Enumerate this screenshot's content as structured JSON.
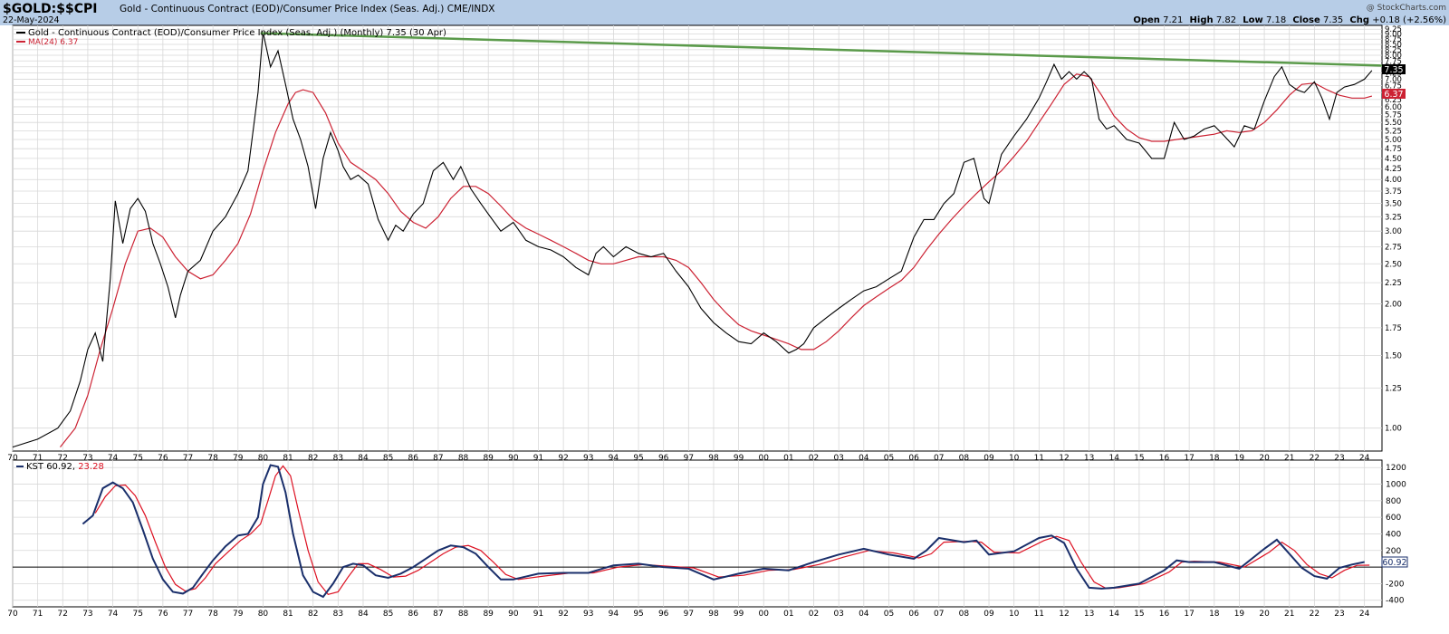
{
  "header": {
    "symbol": "$GOLD:$$CPI",
    "description": "Gold - Continuous Contract (EOD)/Consumer Price Index (Seas. Adj.)",
    "exchange": "CME/INDX",
    "date": "22-May-2024",
    "watermark": "@ StockCharts.com",
    "quote": {
      "open_label": "Open",
      "open": "7.21",
      "high_label": "High",
      "high": "7.82",
      "low_label": "Low",
      "low": "7.18",
      "close_label": "Close",
      "close": "7.35",
      "chg_label": "Chg",
      "chg": "+0.18 (+2.56%)"
    }
  },
  "colors": {
    "header_bg": "#b7cde7",
    "price": "#000000",
    "ma": "#cc2233",
    "trendline": "#5a9a4a",
    "kst": "#1a2f6b",
    "kst_signal": "#dd1122",
    "grid": "#d8d8d8"
  },
  "chart_data": [
    {
      "type": "line",
      "panel": "price",
      "scale": "log",
      "legend": [
        {
          "label": "Gold - Continuous Contract (EOD)/Consumer Price Index (Seas. Adj.) (Monthly) 7.35 (30 Apr)"
        },
        {
          "label": "MA(24) 6.37"
        }
      ],
      "x_ticks": [
        "70",
        "71",
        "72",
        "73",
        "74",
        "75",
        "76",
        "77",
        "78",
        "79",
        "80",
        "81",
        "82",
        "83",
        "84",
        "85",
        "86",
        "87",
        "88",
        "89",
        "90",
        "91",
        "92",
        "93",
        "94",
        "95",
        "96",
        "97",
        "98",
        "99",
        "00",
        "01",
        "02",
        "03",
        "04",
        "05",
        "06",
        "07",
        "08",
        "09",
        "10",
        "11",
        "12",
        "13",
        "14",
        "15",
        "16",
        "17",
        "18",
        "19",
        "20",
        "21",
        "22",
        "23",
        "24"
      ],
      "y_ticks": [
        "1.00",
        "1.25",
        "1.50",
        "1.75",
        "2.00",
        "2.25",
        "2.50",
        "2.75",
        "3.00",
        "3.25",
        "3.50",
        "3.75",
        "4.00",
        "4.25",
        "4.50",
        "4.75",
        "5.00",
        "5.25",
        "5.50",
        "5.75",
        "6.00",
        "6.25",
        "6.50",
        "6.75",
        "7.00",
        "7.25",
        "7.50",
        "7.75",
        "8.00",
        "8.25",
        "8.50",
        "8.75",
        "9.00",
        "9.25"
      ],
      "ylim": [
        0.88,
        9.45
      ],
      "xlim": [
        1970.0,
        2024.7
      ],
      "price_series": {
        "name": "Gold - Continuous Contract (EOD)/Consumer Price Index (Seas. Adj.)",
        "x": [
          1970.0,
          1971.0,
          1971.8,
          1972.3,
          1972.7,
          1973.0,
          1973.3,
          1973.6,
          1973.9,
          1974.1,
          1974.4,
          1974.7,
          1975.0,
          1975.3,
          1975.6,
          1975.9,
          1976.2,
          1976.5,
          1976.7,
          1977.0,
          1977.5,
          1978.0,
          1978.5,
          1979.0,
          1979.4,
          1979.8,
          1980.0,
          1980.3,
          1980.6,
          1980.9,
          1981.2,
          1981.5,
          1981.8,
          1982.1,
          1982.4,
          1982.7,
          1983.0,
          1983.2,
          1983.5,
          1983.8,
          1984.2,
          1984.6,
          1985.0,
          1985.3,
          1985.6,
          1986.0,
          1986.4,
          1986.8,
          1987.2,
          1987.6,
          1987.9,
          1988.3,
          1988.7,
          1989.0,
          1989.5,
          1990.0,
          1990.5,
          1991.0,
          1991.5,
          1992.0,
          1992.5,
          1993.0,
          1993.3,
          1993.6,
          1994.0,
          1994.5,
          1995.0,
          1995.5,
          1996.0,
          1996.5,
          1997.0,
          1997.5,
          1998.0,
          1998.5,
          1999.0,
          1999.5,
          2000.0,
          2000.5,
          2001.0,
          2001.3,
          2001.6,
          2002.0,
          2002.5,
          2003.0,
          2003.5,
          2004.0,
          2004.5,
          2005.0,
          2005.5,
          2006.0,
          2006.4,
          2006.8,
          2007.2,
          2007.6,
          2008.0,
          2008.4,
          2008.8,
          2009.0,
          2009.5,
          2010.0,
          2010.5,
          2011.0,
          2011.3,
          2011.6,
          2011.9,
          2012.2,
          2012.5,
          2012.8,
          2013.1,
          2013.4,
          2013.7,
          2014.0,
          2014.5,
          2015.0,
          2015.5,
          2016.0,
          2016.4,
          2016.8,
          2017.2,
          2017.6,
          2018.0,
          2018.4,
          2018.8,
          2019.2,
          2019.6,
          2020.0,
          2020.4,
          2020.7,
          2021.0,
          2021.3,
          2021.6,
          2022.0,
          2022.3,
          2022.6,
          2022.9,
          2023.2,
          2023.6,
          2024.0,
          2024.3
        ],
        "y": [
          0.9,
          0.94,
          1.0,
          1.1,
          1.3,
          1.55,
          1.7,
          1.45,
          2.3,
          3.55,
          2.8,
          3.4,
          3.6,
          3.35,
          2.8,
          2.5,
          2.2,
          1.85,
          2.1,
          2.4,
          2.55,
          3.0,
          3.25,
          3.7,
          4.2,
          6.5,
          9.1,
          7.5,
          8.2,
          6.8,
          5.6,
          5.0,
          4.3,
          3.4,
          4.5,
          5.2,
          4.7,
          4.3,
          4.0,
          4.1,
          3.9,
          3.2,
          2.85,
          3.1,
          3.0,
          3.3,
          3.5,
          4.2,
          4.4,
          4.0,
          4.3,
          3.8,
          3.5,
          3.3,
          3.0,
          3.15,
          2.85,
          2.75,
          2.7,
          2.6,
          2.45,
          2.35,
          2.65,
          2.75,
          2.6,
          2.75,
          2.65,
          2.6,
          2.65,
          2.4,
          2.2,
          1.95,
          1.8,
          1.7,
          1.62,
          1.6,
          1.7,
          1.62,
          1.52,
          1.55,
          1.6,
          1.75,
          1.85,
          1.95,
          2.05,
          2.15,
          2.2,
          2.3,
          2.4,
          2.9,
          3.2,
          3.2,
          3.5,
          3.7,
          4.4,
          4.5,
          3.6,
          3.5,
          4.6,
          5.1,
          5.6,
          6.3,
          6.9,
          7.6,
          7.0,
          7.3,
          7.0,
          7.3,
          7.0,
          5.6,
          5.3,
          5.4,
          5.0,
          4.9,
          4.5,
          4.5,
          5.5,
          5.0,
          5.1,
          5.3,
          5.4,
          5.1,
          4.8,
          5.4,
          5.3,
          6.2,
          7.1,
          7.5,
          6.8,
          6.6,
          6.5,
          6.9,
          6.3,
          5.6,
          6.5,
          6.7,
          6.8,
          7.0,
          7.35
        ]
      },
      "ma_series": {
        "name": "MA(24)",
        "x": [
          1971.9,
          1972.5,
          1973.0,
          1973.5,
          1974.0,
          1974.5,
          1975.0,
          1975.5,
          1976.0,
          1976.5,
          1977.0,
          1977.5,
          1978.0,
          1978.5,
          1979.0,
          1979.5,
          1980.0,
          1980.5,
          1981.0,
          1981.3,
          1981.6,
          1982.0,
          1982.5,
          1983.0,
          1983.5,
          1984.0,
          1984.5,
          1985.0,
          1985.5,
          1986.0,
          1986.5,
          1987.0,
          1987.5,
          1988.0,
          1988.5,
          1989.0,
          1989.5,
          1990.0,
          1990.5,
          1991.0,
          1991.5,
          1992.0,
          1992.5,
          1993.0,
          1993.5,
          1994.0,
          1994.5,
          1995.0,
          1995.5,
          1996.0,
          1996.5,
          1997.0,
          1997.5,
          1998.0,
          1998.5,
          1999.0,
          1999.5,
          2000.0,
          2000.5,
          2001.0,
          2001.5,
          2002.0,
          2002.5,
          2003.0,
          2003.5,
          2004.0,
          2004.5,
          2005.0,
          2005.5,
          2006.0,
          2006.5,
          2007.0,
          2007.5,
          2008.0,
          2008.5,
          2009.0,
          2009.5,
          2010.0,
          2010.5,
          2011.0,
          2011.5,
          2012.0,
          2012.5,
          2013.0,
          2013.5,
          2014.0,
          2014.5,
          2015.0,
          2015.5,
          2016.0,
          2016.5,
          2017.0,
          2017.5,
          2018.0,
          2018.5,
          2019.0,
          2019.5,
          2020.0,
          2020.5,
          2021.0,
          2021.5,
          2022.0,
          2022.5,
          2023.0,
          2023.5,
          2024.0,
          2024.3
        ],
        "y": [
          0.9,
          1.0,
          1.2,
          1.55,
          1.95,
          2.5,
          3.0,
          3.05,
          2.9,
          2.6,
          2.4,
          2.3,
          2.35,
          2.55,
          2.8,
          3.3,
          4.2,
          5.2,
          6.1,
          6.5,
          6.6,
          6.5,
          5.8,
          4.9,
          4.4,
          4.2,
          4.0,
          3.7,
          3.35,
          3.15,
          3.05,
          3.25,
          3.6,
          3.85,
          3.85,
          3.7,
          3.45,
          3.2,
          3.05,
          2.95,
          2.85,
          2.75,
          2.65,
          2.55,
          2.5,
          2.5,
          2.55,
          2.6,
          2.6,
          2.6,
          2.55,
          2.45,
          2.25,
          2.05,
          1.9,
          1.78,
          1.72,
          1.68,
          1.64,
          1.6,
          1.55,
          1.55,
          1.62,
          1.72,
          1.85,
          1.98,
          2.08,
          2.18,
          2.28,
          2.45,
          2.7,
          2.95,
          3.2,
          3.45,
          3.7,
          3.95,
          4.2,
          4.55,
          4.95,
          5.5,
          6.1,
          6.8,
          7.2,
          7.1,
          6.4,
          5.7,
          5.3,
          5.05,
          4.95,
          4.95,
          5.0,
          5.05,
          5.1,
          5.15,
          5.25,
          5.2,
          5.25,
          5.5,
          5.9,
          6.4,
          6.8,
          6.85,
          6.6,
          6.4,
          6.3,
          6.3,
          6.37
        ]
      },
      "trendline": {
        "x": [
          1979.9,
          2024.7
        ],
        "y": [
          9.05,
          7.55
        ]
      },
      "last_value_labels": {
        "price": "7.35",
        "ma": "6.37"
      }
    },
    {
      "type": "line",
      "panel": "KST",
      "legend": [
        {
          "label": "KST 60.92,",
          "value": "60.92"
        },
        {
          "label": "23.28",
          "value": "23.28"
        }
      ],
      "x_ticks": [
        "70",
        "71",
        "72",
        "73",
        "74",
        "75",
        "76",
        "77",
        "78",
        "79",
        "80",
        "81",
        "82",
        "83",
        "84",
        "85",
        "86",
        "87",
        "88",
        "89",
        "90",
        "91",
        "92",
        "93",
        "94",
        "95",
        "96",
        "97",
        "98",
        "99",
        "00",
        "01",
        "02",
        "03",
        "04",
        "05",
        "06",
        "07",
        "08",
        "09",
        "10",
        "11",
        "12",
        "13",
        "14",
        "15",
        "16",
        "17",
        "18",
        "19",
        "20",
        "21",
        "22",
        "23",
        "24"
      ],
      "y_ticks": [
        "1200",
        "1000",
        "800",
        "600",
        "400",
        "200",
        "-200",
        "-400"
      ],
      "ylim": [
        -480,
        1290
      ],
      "zero_line": 0,
      "last_value_label": "60.92",
      "kst_series": {
        "name": "KST",
        "x": [
          1972.8,
          1973.2,
          1973.6,
          1974.0,
          1974.4,
          1974.8,
          1975.2,
          1975.6,
          1976.0,
          1976.4,
          1976.8,
          1977.2,
          1977.6,
          1978.0,
          1978.5,
          1979.0,
          1979.4,
          1979.8,
          1980.0,
          1980.3,
          1980.6,
          1980.9,
          1981.2,
          1981.6,
          1982.0,
          1982.4,
          1982.8,
          1983.2,
          1983.6,
          1984.0,
          1984.5,
          1985.0,
          1985.5,
          1986.0,
          1986.5,
          1987.0,
          1987.5,
          1988.0,
          1988.5,
          1989.0,
          1989.5,
          1990.0,
          1991.0,
          1992.0,
          1993.0,
          1994.0,
          1995.0,
          1996.0,
          1997.0,
          1998.0,
          1999.0,
          2000.0,
          2001.0,
          2002.0,
          2003.0,
          2004.0,
          2005.0,
          2006.0,
          2006.5,
          2007.0,
          2008.0,
          2008.5,
          2009.0,
          2010.0,
          2011.0,
          2011.5,
          2012.0,
          2012.5,
          2013.0,
          2013.5,
          2014.0,
          2015.0,
          2016.0,
          2016.5,
          2017.0,
          2018.0,
          2019.0,
          2020.0,
          2020.5,
          2021.0,
          2021.5,
          2022.0,
          2022.5,
          2023.0,
          2023.5,
          2024.0,
          2024.3
        ],
        "y": [
          520,
          620,
          950,
          1020,
          950,
          780,
          450,
          100,
          -150,
          -300,
          -320,
          -250,
          -80,
          80,
          250,
          380,
          400,
          600,
          1000,
          1230,
          1210,
          900,
          400,
          -100,
          -300,
          -360,
          -200,
          0,
          40,
          20,
          -100,
          -130,
          -80,
          0,
          100,
          200,
          260,
          240,
          160,
          0,
          -150,
          -150,
          -80,
          -70,
          -70,
          20,
          40,
          0,
          -20,
          -150,
          -80,
          -20,
          -40,
          60,
          150,
          220,
          150,
          100,
          200,
          350,
          300,
          320,
          150,
          190,
          350,
          380,
          290,
          -20,
          -250,
          -260,
          -250,
          -200,
          -40,
          80,
          60,
          60,
          -20,
          220,
          330,
          160,
          -10,
          -110,
          -140,
          -10,
          30,
          61
        ]
      },
      "signal_series": {
        "name": "Signal",
        "x": [
          1973.3,
          1973.7,
          1974.1,
          1974.5,
          1974.9,
          1975.3,
          1975.7,
          1976.1,
          1976.5,
          1976.9,
          1977.3,
          1977.7,
          1978.1,
          1978.6,
          1979.1,
          1979.5,
          1979.9,
          1980.2,
          1980.5,
          1980.8,
          1981.1,
          1981.4,
          1981.8,
          1982.2,
          1982.6,
          1983.0,
          1983.4,
          1983.8,
          1984.2,
          1984.7,
          1985.2,
          1985.7,
          1986.2,
          1986.7,
          1987.2,
          1987.7,
          1988.2,
          1988.7,
          1989.2,
          1989.7,
          1990.2,
          1991.2,
          1992.2,
          1993.2,
          1994.2,
          1995.2,
          1996.2,
          1997.2,
          1998.2,
          1999.2,
          2000.2,
          2001.2,
          2002.2,
          2003.2,
          2004.2,
          2005.2,
          2006.2,
          2006.7,
          2007.2,
          2008.2,
          2008.7,
          2009.2,
          2010.2,
          2011.2,
          2011.7,
          2012.2,
          2012.7,
          2013.2,
          2013.7,
          2014.2,
          2015.2,
          2016.2,
          2016.7,
          2017.2,
          2018.2,
          2019.2,
          2020.2,
          2020.7,
          2021.2,
          2021.7,
          2022.2,
          2022.7,
          2023.2,
          2023.7,
          2024.2,
          2024.5
        ],
        "y": [
          650,
          850,
          980,
          990,
          860,
          620,
          300,
          0,
          -210,
          -290,
          -260,
          -130,
          40,
          180,
          320,
          400,
          520,
          800,
          1100,
          1220,
          1100,
          700,
          200,
          -180,
          -330,
          -300,
          -120,
          40,
          40,
          -30,
          -120,
          -110,
          -40,
          60,
          160,
          240,
          260,
          200,
          60,
          -90,
          -150,
          -110,
          -75,
          -70,
          0,
          30,
          10,
          -10,
          -120,
          -100,
          -40,
          -30,
          30,
          120,
          200,
          170,
          110,
          160,
          300,
          310,
          300,
          180,
          170,
          320,
          370,
          320,
          50,
          -180,
          -260,
          -250,
          -200,
          -60,
          60,
          70,
          60,
          0,
          180,
          300,
          200,
          30,
          -80,
          -130,
          -40,
          20,
          23
        ]
      }
    }
  ]
}
